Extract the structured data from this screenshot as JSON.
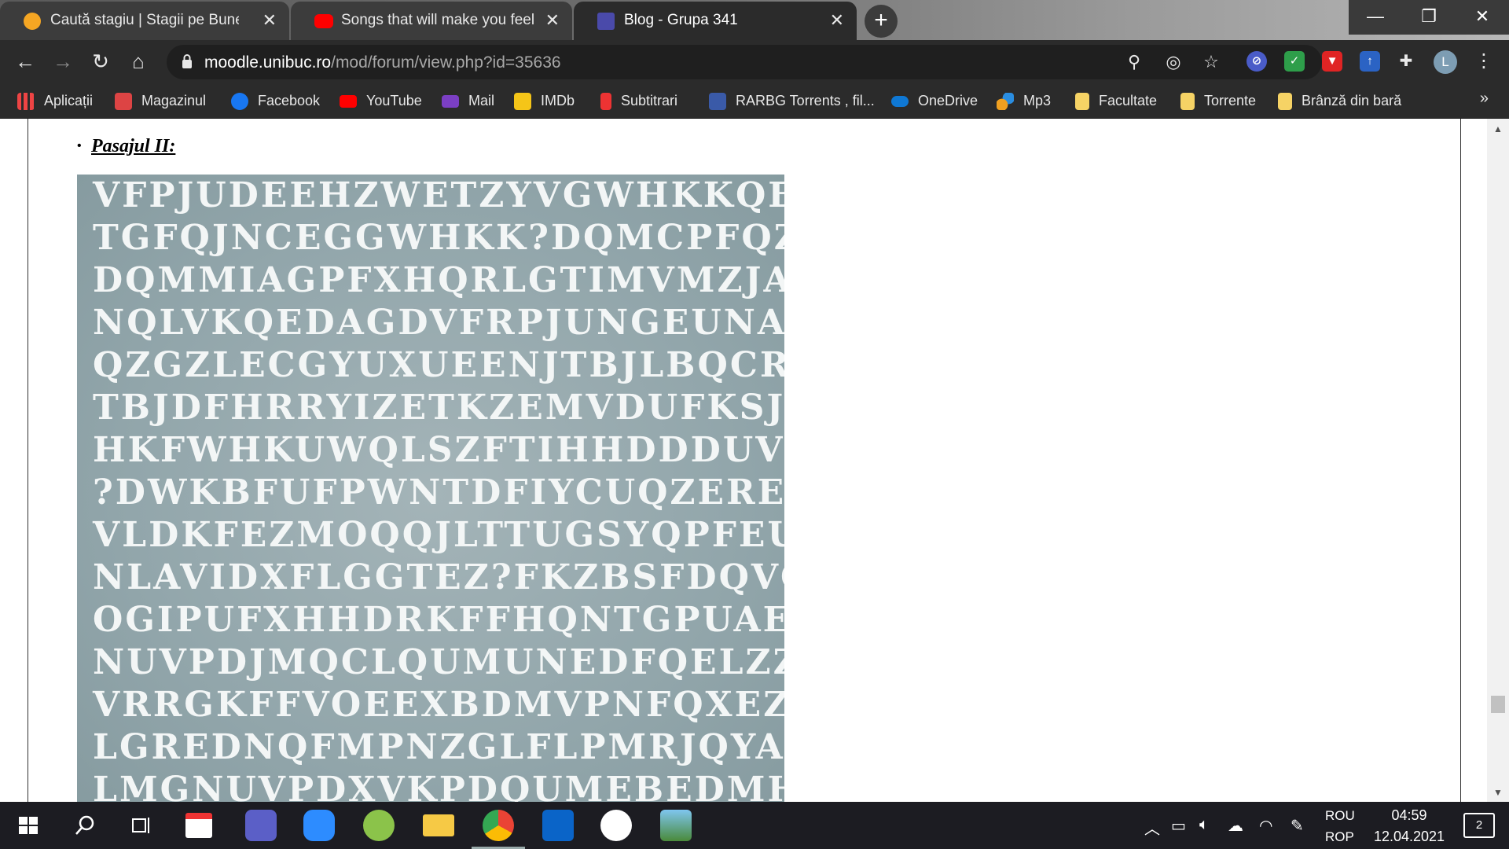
{
  "browser": {
    "tabs": [
      {
        "title": "Caută stagiu | Stagii pe Bune",
        "favicon": "stagii-favicon",
        "color": "#f5a623"
      },
      {
        "title": "Songs that will make you feel like",
        "favicon": "youtube-favicon",
        "color": "#ff0000"
      },
      {
        "title": "Blog - Grupa 341",
        "favicon": "unibuc-favicon",
        "color": "#4a4aaa"
      }
    ],
    "url_host": "moodle.unibuc.ro",
    "url_path": "/mod/forum/view.php?id=35636",
    "profile_initial": "L"
  },
  "bookmarks": [
    {
      "label": "Aplicații",
      "icon": "apps-grid-icon",
      "color": "#e44"
    },
    {
      "label": "Magazinul",
      "icon": "store-icon",
      "color": "#d44"
    },
    {
      "label": "Facebook",
      "icon": "facebook-icon",
      "color": "#1877f2"
    },
    {
      "label": "YouTube",
      "icon": "youtube-icon",
      "color": "#ff0000"
    },
    {
      "label": "Mail",
      "icon": "mail-icon",
      "color": "#7b3fc4"
    },
    {
      "label": "IMDb",
      "icon": "imdb-icon",
      "color": "#f5c518"
    },
    {
      "label": "Subtitrari",
      "icon": "subtitrari-icon",
      "color": "#e33"
    },
    {
      "label": "RARBG Torrents , fil...",
      "icon": "rarbg-icon",
      "color": "#3a5aa8"
    },
    {
      "label": "OneDrive",
      "icon": "onedrive-icon",
      "color": "#0f78d4"
    },
    {
      "label": "Mp3",
      "icon": "mp3-icon",
      "color": "#f0a020"
    },
    {
      "label": "Facultate",
      "icon": "folder-icon",
      "color": "#f6d365"
    },
    {
      "label": "Torrente",
      "icon": "folder-icon",
      "color": "#f6d365"
    },
    {
      "label": "Brânză din bară",
      "icon": "folder-icon",
      "color": "#f6d365"
    }
  ],
  "page": {
    "bullet": "•",
    "heading": "Pasajul II:",
    "puzzle_rows": [
      "VFPJUDEEHZWETZYVGWHKKQE",
      "TGFQJNCEGGWHKK?DQMCPFQZ",
      "DQMMIAGPFXHQRLGTIMVMZJA",
      "NQLVKQEDAGDVFRPJUNGEUNA",
      "QZGZLECGYUXUEENJTBJLBQCR",
      "TBJDFHRRYIZETKZEMVDUFKSJ",
      "HKFWHKUWQLSZFTIHHDDDUVH",
      "?DWKBFUFPWNTDFIYCUQZEREE",
      "VLDKFEZMOQQJLTTUGSYQPFEU",
      "NLAVIDXFLGGTEZ?FKZBSFDQVG",
      "OGIPUFXHHDRKFFHQNTGPUAEC",
      "NUVPDJMQCLQUMUNEDFQELZZ",
      "VRRGKFFVOEEXBDMVPNFQXEZ",
      "LGREDNQFMPNZGLFLPMRJQYA",
      "LMGNUVPDXVKPDQUMEBEDMH"
    ]
  },
  "taskbar": {
    "lang_top": "ROU",
    "lang_bottom": "ROP",
    "time": "04:59",
    "date": "12.04.2021",
    "notification_count": "2"
  }
}
